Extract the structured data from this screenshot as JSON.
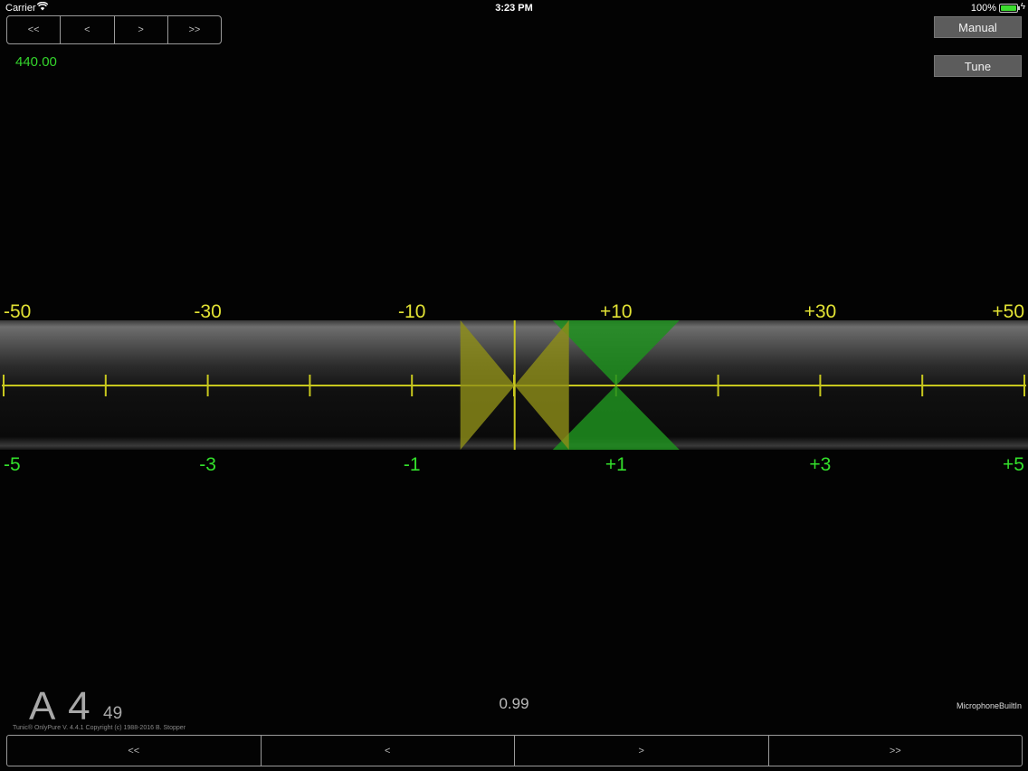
{
  "status_bar": {
    "carrier": "Carrier",
    "time": "3:23 PM",
    "battery": "100%"
  },
  "top_nav": {
    "buttons": [
      "<<",
      "<",
      ">",
      ">>"
    ]
  },
  "reference_frequency": "440.00",
  "right_buttons": {
    "manual": "Manual",
    "tune": "Tune"
  },
  "meter": {
    "cents_labels": [
      "-50",
      "-30",
      "-10",
      "+10",
      "+30",
      "+50"
    ],
    "hz_labels": [
      "-5",
      "-3",
      "-1",
      "+1",
      "+3",
      "+5"
    ],
    "colors": {
      "cents": "#e2e234",
      "hz": "#33e02b",
      "yellow_indicator": "#8f8f18",
      "green_indicator": "#1e8f1e"
    },
    "yellow_indicator_cents": -1,
    "green_indicator_hz": 1
  },
  "reading": {
    "note": "A 4",
    "cents": "49",
    "clarity": "0.99"
  },
  "input_source": "MicrophoneBuiltIn",
  "copyright": "Tunic® OnlyPure V. 4.4.1 Copyright (c) 1988-2016 B. Stopper",
  "bottom_nav": {
    "buttons": [
      "<<",
      "<",
      ">",
      ">>"
    ]
  }
}
